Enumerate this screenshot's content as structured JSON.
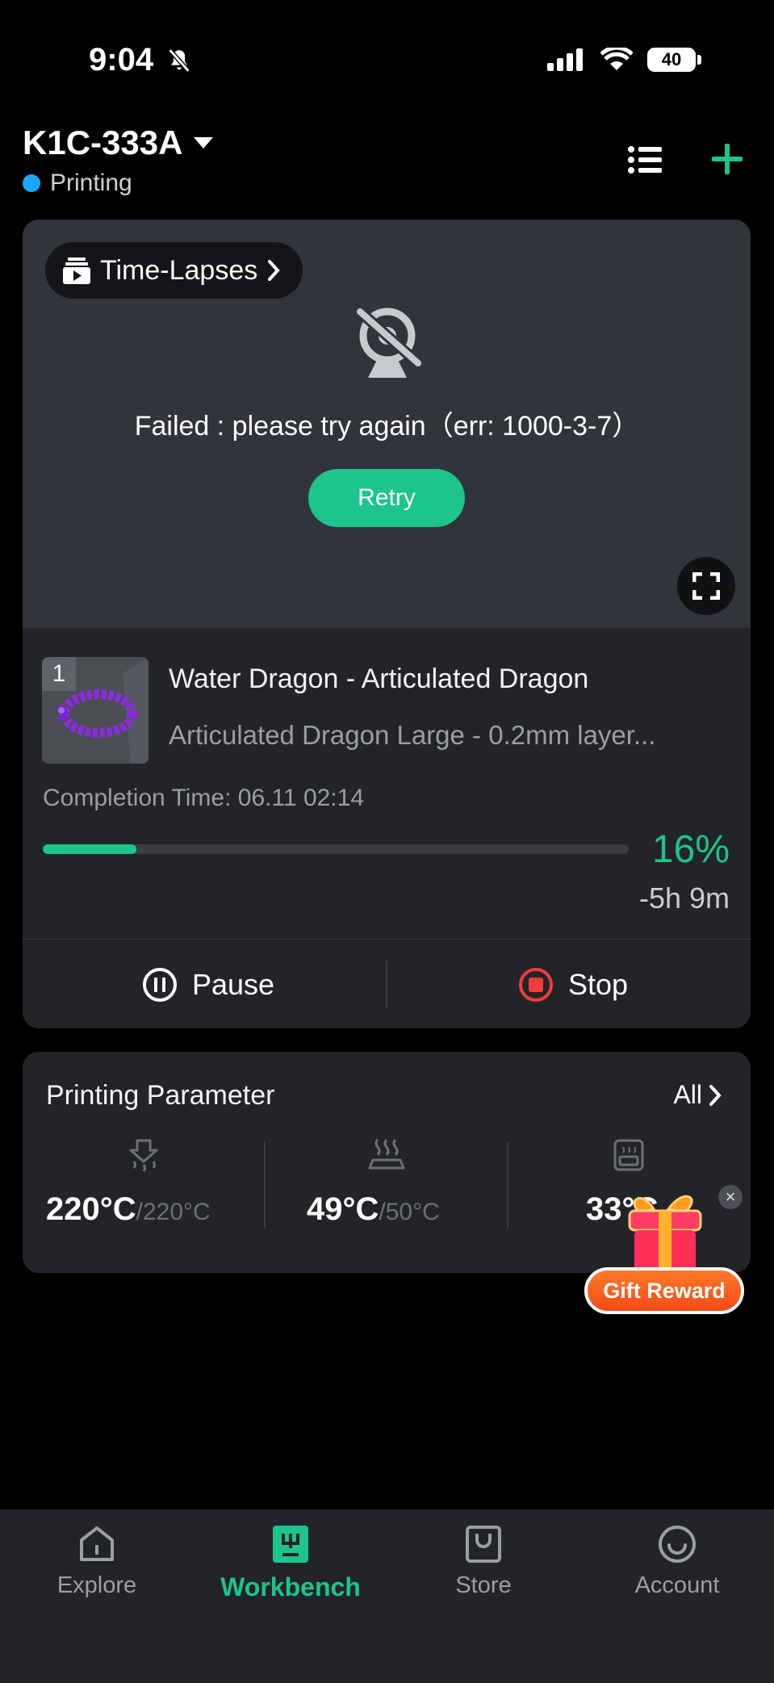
{
  "status_bar": {
    "time": "9:04",
    "battery": "40"
  },
  "header": {
    "printer_name": "K1C-333A",
    "status": "Printing"
  },
  "camera": {
    "timelapse_label": "Time-Lapses",
    "error_message": "Failed : please try again（err: 1000-3-7）",
    "retry_label": "Retry"
  },
  "job": {
    "plate_number": "1",
    "title": "Water Dragon - Articulated Dragon",
    "subtitle": "Articulated Dragon Large - 0.2mm layer...",
    "completion_time": "Completion Time: 06.11 02:14",
    "progress_percent": 16,
    "progress_label": "16%",
    "remaining": "-5h 9m",
    "pause_label": "Pause",
    "stop_label": "Stop"
  },
  "parameters": {
    "title": "Printing Parameter",
    "all_label": "All",
    "nozzle": {
      "current": "220°C",
      "target": "/220°C"
    },
    "bed": {
      "current": "49°C",
      "target": "/50°C"
    },
    "chamber": {
      "current": "33°C"
    }
  },
  "gift": {
    "label": "Gift Reward",
    "close": "×"
  },
  "nav": [
    {
      "label": "Explore",
      "icon": "home-icon"
    },
    {
      "label": "Workbench",
      "icon": "workbench-icon"
    },
    {
      "label": "Store",
      "icon": "bag-icon"
    },
    {
      "label": "Account",
      "icon": "smile-icon"
    }
  ],
  "colors": {
    "accent": "#1dc48b",
    "status_dot": "#1aa7ff",
    "stop": "#f23c3c"
  }
}
